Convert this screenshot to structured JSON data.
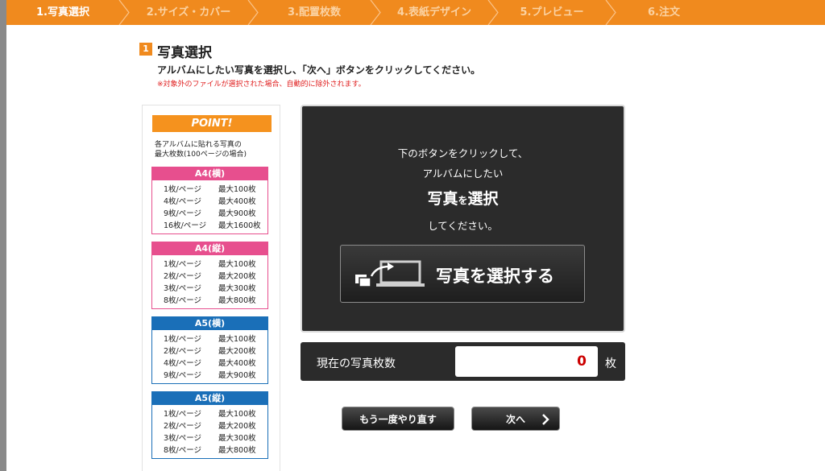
{
  "steps": [
    {
      "label": "1.写真選択",
      "active": true
    },
    {
      "label": "2.サイズ・カバー",
      "active": false
    },
    {
      "label": "3.配置枚数",
      "active": false
    },
    {
      "label": "4.表紙デザイン",
      "active": false
    },
    {
      "label": "5.プレビュー",
      "active": false
    },
    {
      "label": "6.注文",
      "active": false
    }
  ],
  "heading": {
    "number": "1",
    "title": "写真選択",
    "instruction": "アルバムにしたい写真を選択し、「次へ」ボタンをクリックしてください。",
    "note": "※対象外のファイルが選択された場合、自動的に除外されます。"
  },
  "point": {
    "title": "POINT!",
    "desc_line1": "各アルバムに貼れる写真の",
    "desc_line2": "最大枚数(100ページの場合)",
    "boxes": [
      {
        "title": "A4(横)",
        "color": "#e74f8e",
        "rows": [
          {
            "l": "1枚/ページ",
            "r": "最大100枚"
          },
          {
            "l": "4枚/ページ",
            "r": "最大400枚"
          },
          {
            "l": "9枚/ページ",
            "r": "最大900枚"
          },
          {
            "l": "16枚/ページ",
            "r": "最大1600枚"
          }
        ]
      },
      {
        "title": "A4(縦)",
        "color": "#e74f8e",
        "rows": [
          {
            "l": "1枚/ページ",
            "r": "最大100枚"
          },
          {
            "l": "2枚/ページ",
            "r": "最大200枚"
          },
          {
            "l": "3枚/ページ",
            "r": "最大300枚"
          },
          {
            "l": "8枚/ページ",
            "r": "最大800枚"
          }
        ]
      },
      {
        "title": "A5(横)",
        "color": "#1a6fb8",
        "rows": [
          {
            "l": "1枚/ページ",
            "r": "最大100枚"
          },
          {
            "l": "2枚/ページ",
            "r": "最大200枚"
          },
          {
            "l": "4枚/ページ",
            "r": "最大400枚"
          },
          {
            "l": "9枚/ページ",
            "r": "最大900枚"
          }
        ]
      },
      {
        "title": "A5(縦)",
        "color": "#1a6fb8",
        "rows": [
          {
            "l": "1枚/ページ",
            "r": "最大100枚"
          },
          {
            "l": "2枚/ページ",
            "r": "最大200枚"
          },
          {
            "l": "3枚/ページ",
            "r": "最大300枚"
          },
          {
            "l": "8枚/ページ",
            "r": "最大800枚"
          }
        ]
      }
    ]
  },
  "main": {
    "line1": "下のボタンをクリックして、",
    "line2": "アルバムにしたい",
    "line3_a": "写真",
    "line3_b": "を",
    "line3_c": "選択",
    "line4": "してください。",
    "select_button": "写真を選択する",
    "select_icon": "photo-upload-icon"
  },
  "counter": {
    "label": "現在の写真枚数",
    "value": "0",
    "unit": "枚"
  },
  "buttons": {
    "redo": "もう一度やり直す",
    "next": "次へ",
    "next_icon": "chevron-right-icon"
  },
  "colors": {
    "accent": "#f08a1e",
    "pink": "#e74f8e",
    "blue": "#1a6fb8",
    "count_red": "#cc0000"
  }
}
